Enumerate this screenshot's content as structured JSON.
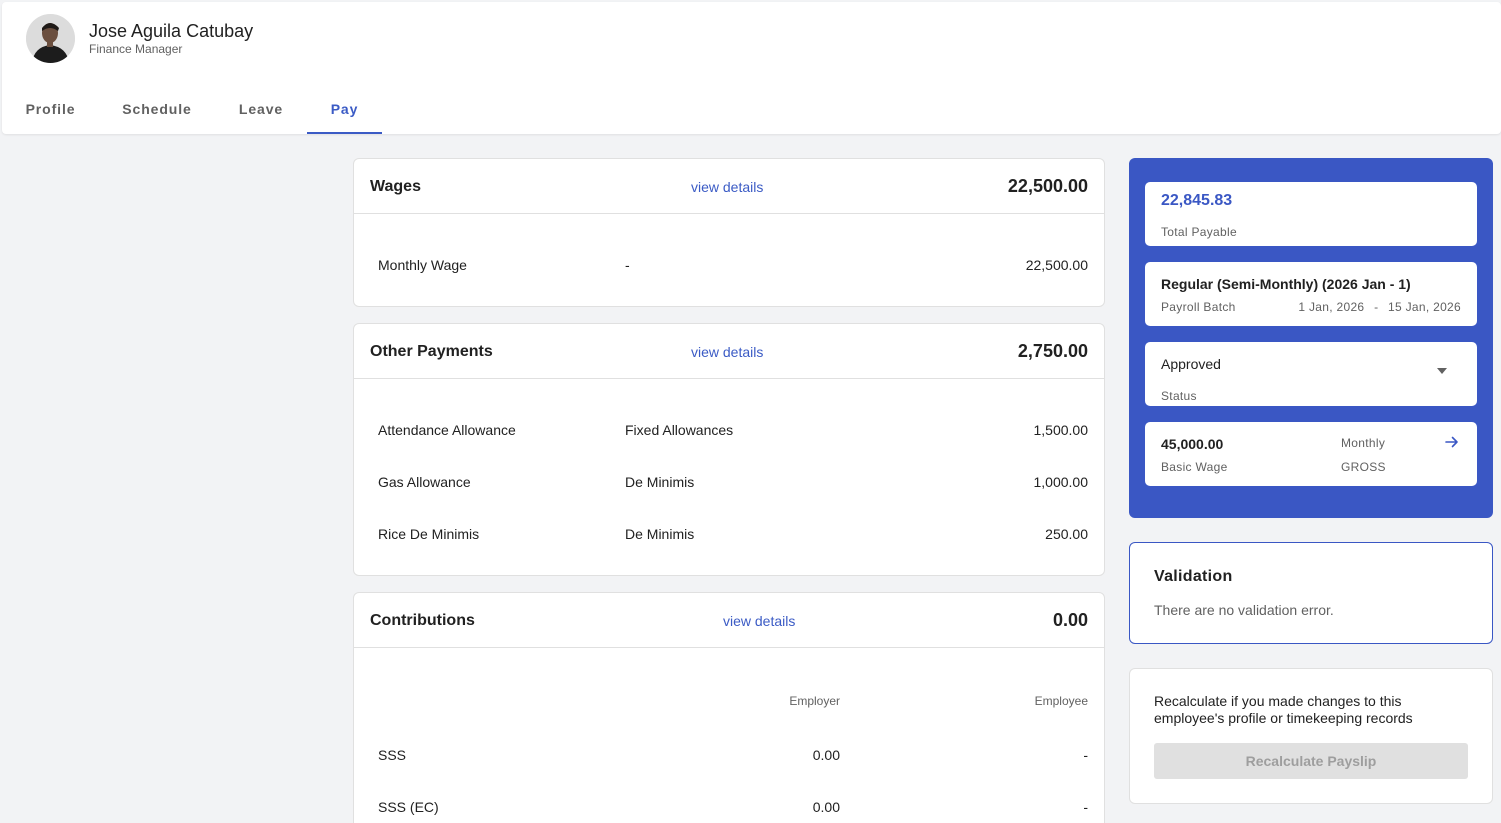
{
  "employee": {
    "name": "Jose Aguila Catubay",
    "title": "Finance Manager"
  },
  "tabs": [
    {
      "label": "Profile"
    },
    {
      "label": "Schedule"
    },
    {
      "label": "Leave"
    },
    {
      "label": "Pay"
    }
  ],
  "active_tab": "Pay",
  "wages": {
    "title": "Wages",
    "link": "view details",
    "total": "22,500.00",
    "rows": [
      {
        "name": "Monthly Wage",
        "type": "-",
        "amount": "22,500.00"
      }
    ]
  },
  "other_payments": {
    "title": "Other Payments",
    "link": "view details",
    "total": "2,750.00",
    "rows": [
      {
        "name": "Attendance Allowance",
        "type": "Fixed Allowances",
        "amount": "1,500.00"
      },
      {
        "name": "Gas Allowance",
        "type": "De Minimis",
        "amount": "1,000.00"
      },
      {
        "name": "Rice De Minimis",
        "type": "De Minimis",
        "amount": "250.00"
      }
    ]
  },
  "contributions": {
    "title": "Contributions",
    "link": "view details",
    "total": "0.00",
    "col_employer": "Employer",
    "col_employee": "Employee",
    "rows": [
      {
        "name": "SSS",
        "employer": "0.00",
        "employee": "-"
      },
      {
        "name": "SSS (EC)",
        "employer": "0.00",
        "employee": "-"
      }
    ]
  },
  "summary": {
    "total_payable_value": "22,845.83",
    "total_payable_label": "Total Payable",
    "batch_title": "Regular (Semi-Monthly) (2026 Jan - 1)",
    "batch_label": "Payroll Batch",
    "batch_start": "1 Jan, 2026",
    "batch_sep": "-",
    "batch_end": "15 Jan, 2026",
    "status_value": "Approved",
    "status_label": "Status",
    "basic_wage_value": "45,000.00",
    "basic_wage_label": "Basic Wage",
    "basic_wage_period": "Monthly",
    "basic_wage_type": "GROSS"
  },
  "validation": {
    "title": "Validation",
    "message": "There are no validation error."
  },
  "recalculate": {
    "message": "Recalculate if you made changes to this employee's profile or timekeeping records",
    "button": "Recalculate Payslip"
  },
  "colors": {
    "accent": "#3a57c4",
    "link": "#3b5bc5",
    "border": "#e0e0e0",
    "background": "#f2f3f5"
  },
  "icons": {
    "status_dropdown": "caret-down-icon",
    "basic_wage_arrow": "arrow-right-icon"
  }
}
